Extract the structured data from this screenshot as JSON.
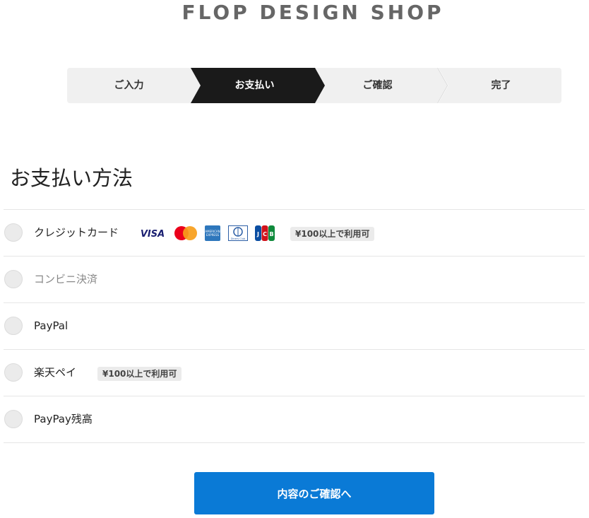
{
  "shop_name": "FLOP DESIGN SHOP",
  "steps": [
    {
      "label": "ご入力",
      "active": false
    },
    {
      "label": "お支払い",
      "active": true
    },
    {
      "label": "ご確認",
      "active": false
    },
    {
      "label": "完了",
      "active": false
    }
  ],
  "heading": "お支払い方法",
  "methods": [
    {
      "label": "クレジットカード",
      "badge": "¥100以上で利用可",
      "disabled": false
    },
    {
      "label": "コンビニ決済",
      "disabled": true
    },
    {
      "label": "PayPal",
      "disabled": false
    },
    {
      "label": "楽天ペイ",
      "badge": "¥100以上で利用可",
      "disabled": false
    },
    {
      "label": "PayPay残高",
      "disabled": false
    }
  ],
  "cards": {
    "visa_text": "VISA",
    "amex_text": "AMERICAN EXPRESS",
    "diners_text": "Diners Club",
    "jcb_text": "JCB",
    "colors": {
      "visa": "#1a1f71",
      "mc_red": "#eb001b",
      "mc_yellow": "#f79e1b",
      "amex": "#2e77bc",
      "jcb_blue": "#0b4ea2",
      "jcb_red": "#d0121b",
      "jcb_green": "#0f8a3c"
    }
  },
  "submit_label": "内容のご確認へ",
  "colors": {
    "accent": "#0a7ad6",
    "active_step": "#1a1a1a",
    "step_bg": "#f0f0f0"
  }
}
